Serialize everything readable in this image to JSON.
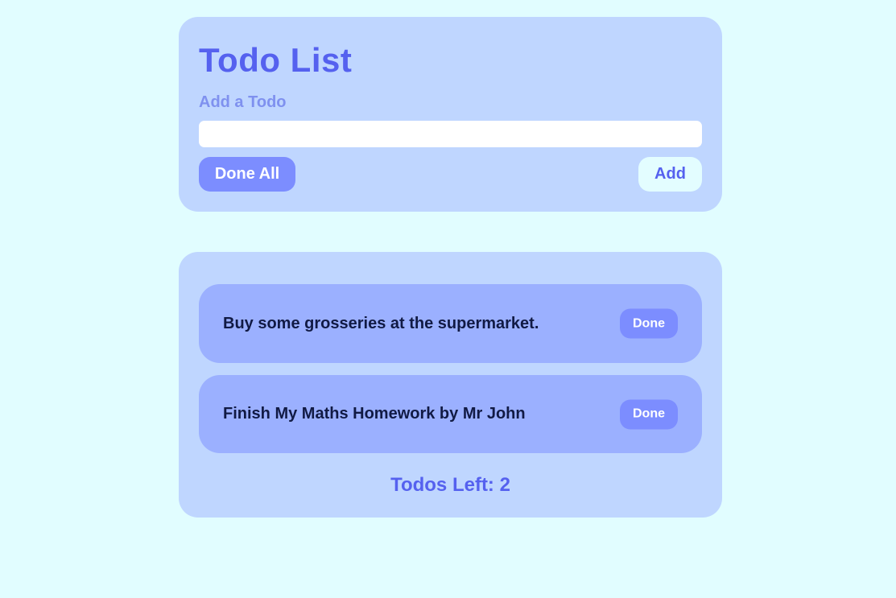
{
  "header": {
    "title": "Todo List",
    "add_label": "Add a Todo",
    "input_value": "",
    "done_all_label": "Done All",
    "add_label_button": "Add"
  },
  "todos": [
    {
      "text": "Buy some grosseries at the supermarket.",
      "done_label": "Done"
    },
    {
      "text": "Finish My Maths Homework by Mr John",
      "done_label": "Done"
    }
  ],
  "footer": {
    "todos_left": "Todos Left: 2"
  },
  "colors": {
    "background": "#e1fdff",
    "card": "#bfd6ff",
    "item": "#9bb0ff",
    "accent": "#5561ef",
    "button": "#7c8dff"
  }
}
